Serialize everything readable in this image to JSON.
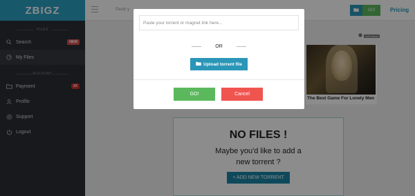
{
  "sidebar": {
    "logo": "ZBIGZ",
    "section_files": "FILES",
    "section_account": "ACCOUNT",
    "items": [
      {
        "label": "Search",
        "icon": "search-icon",
        "badge": "NEW"
      },
      {
        "label": "My Files",
        "icon": "dashboard-icon",
        "badge": ""
      },
      {
        "label": "Payment",
        "icon": "folder-icon",
        "badge": "2X"
      },
      {
        "label": "Profile",
        "icon": "user-icon",
        "badge": ""
      },
      {
        "label": "Support",
        "icon": "gear-icon",
        "badge": ""
      },
      {
        "label": "Logout",
        "icon": "power-icon",
        "badge": ""
      }
    ]
  },
  "topbar": {
    "input_text": "Paste y",
    "go_label": "GO!",
    "pricing_label": "Pricing"
  },
  "ad": {
    "adchoices_label": "AdChoices",
    "caption": "The Best Game For Lonely Men"
  },
  "empty_state": {
    "title": "NO FILES !",
    "subtitle_line1": "Maybe you'd like to add a",
    "subtitle_line2": "new torrent ?",
    "button_label": "+ ADD NEW TORRENT"
  },
  "modal": {
    "input_placeholder": "Paste your torrent or magnet link here...",
    "or_label": "OR",
    "upload_label": "Upload torrent file",
    "go_label": "GO!",
    "cancel_label": "Cancel"
  },
  "colors": {
    "accent": "#2da0c3",
    "go_green": "#5cb85c",
    "cancel_red": "#f0544f",
    "sidebar_bg": "#2a2e33"
  }
}
